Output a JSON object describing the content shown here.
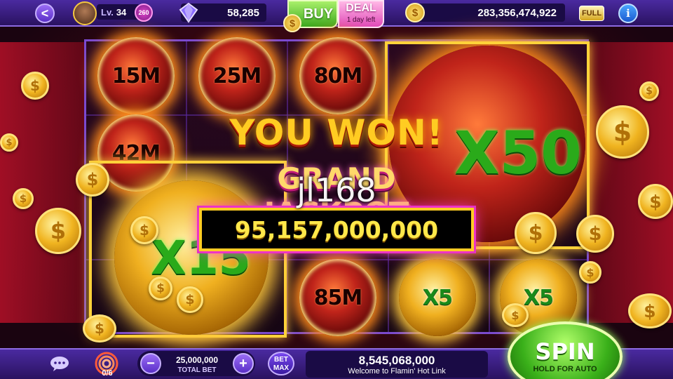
{
  "header": {
    "back_glyph": "<",
    "level_prefix": "Lv.",
    "level": "34",
    "level_badge": "260",
    "gems": "58,285",
    "buy_label": "BUY",
    "deal_label": "DEAL",
    "deal_timer": "1 day left",
    "coins": "283,356,474,922",
    "full_badge": "FULL",
    "info_glyph": "i"
  },
  "reels": {
    "orbs": [
      "15M",
      "25M",
      "80M",
      "42M",
      "85M"
    ],
    "gold_orbs": [
      "X5",
      "X5"
    ],
    "big_multiplier": "X50",
    "tall_multiplier": "X15"
  },
  "win_overlay": {
    "headline": "YOU WON!",
    "subtitle": "GRAND JACKPOT",
    "amount": "95,157,000,000",
    "watermark": "jl168"
  },
  "coin_symbol": "$",
  "footer": {
    "target_count": "0/6",
    "total_bet": "25,000,000",
    "total_bet_label": "TOTAL BET",
    "minus_glyph": "−",
    "plus_glyph": "+",
    "bet_max_line1": "BET",
    "bet_max_line2": "MAX",
    "win_value": "8,545,068,000",
    "win_message": "Welcome to Flamin' Hot Link",
    "spin_label": "SPIN",
    "spin_sub": "HOLD FOR AUTO"
  },
  "colors": {
    "accent_purple": "#4a2aa0",
    "gold": "#ffcc22",
    "green_multiplier": "#2aaa1a",
    "fire_red": "#c0241a"
  },
  "icons": [
    "back-icon",
    "avatar",
    "gem-icon",
    "coin-icon",
    "info-icon",
    "chat-icon",
    "target-icon"
  ]
}
